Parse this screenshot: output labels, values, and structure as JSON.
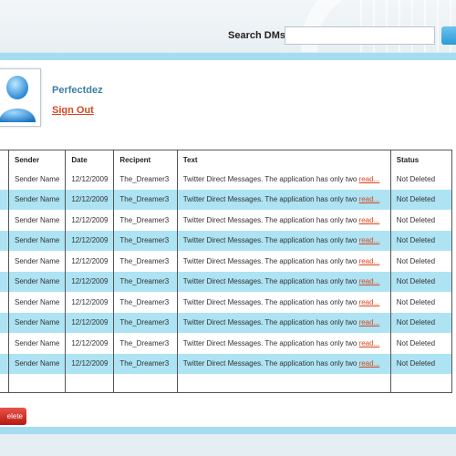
{
  "search": {
    "label": "Search DMs",
    "value": "",
    "placeholder": ""
  },
  "user": {
    "name": "Perfectdez",
    "sign_out": "Sign Out"
  },
  "table": {
    "headers": {
      "sender": "Sender",
      "date": "Date",
      "recipient": "Recipent",
      "text": "Text",
      "status": "Status"
    },
    "rows": [
      {
        "sender": "Sender Name",
        "date": "12/12/2009",
        "recipient": "The_Dreamer3",
        "text": "Twitter Direct Messages. The application has only two",
        "read": "read...",
        "status": "Not Deleted"
      },
      {
        "sender": "Sender Name",
        "date": "12/12/2009",
        "recipient": "The_Dreamer3",
        "text": "Twitter Direct Messages. The application has only two",
        "read": "read...",
        "status": "Not Deleted"
      },
      {
        "sender": "Sender Name",
        "date": "12/12/2009",
        "recipient": "The_Dreamer3",
        "text": "Twitter Direct Messages. The application has only two",
        "read": "read...",
        "status": "Not Deleted"
      },
      {
        "sender": "Sender Name",
        "date": "12/12/2009",
        "recipient": "The_Dreamer3",
        "text": "Twitter Direct Messages. The application has only two",
        "read": "read...",
        "status": "Not Deleted"
      },
      {
        "sender": "Sender Name",
        "date": "12/12/2009",
        "recipient": "The_Dreamer3",
        "text": "Twitter Direct Messages. The application has only two",
        "read": "read...",
        "status": "Not Deleted"
      },
      {
        "sender": "Sender Name",
        "date": "12/12/2009",
        "recipient": "The_Dreamer3",
        "text": "Twitter Direct Messages. The application has only two",
        "read": "read...",
        "status": "Not Deleted"
      },
      {
        "sender": "Sender Name",
        "date": "12/12/2009",
        "recipient": "The_Dreamer3",
        "text": "Twitter Direct Messages. The application has only two",
        "read": "read...",
        "status": "Not Deleted"
      },
      {
        "sender": "Sender Name",
        "date": "12/12/2009",
        "recipient": "The_Dreamer3",
        "text": "Twitter Direct Messages. The application has only two",
        "read": "read...",
        "status": "Not Deleted"
      },
      {
        "sender": "Sender Name",
        "date": "12/12/2009",
        "recipient": "The_Dreamer3",
        "text": "Twitter Direct Messages. The application has only two",
        "read": "read...",
        "status": "Not Deleted"
      },
      {
        "sender": "Sender Name",
        "date": "12/12/2009",
        "recipient": "The_Dreamer3",
        "text": "Twitter Direct Messages. The application has only two",
        "read": "read...",
        "status": "Not Deleted"
      }
    ]
  },
  "actions": {
    "delete_label": "elete"
  },
  "colors": {
    "accent": "#a6dcf0",
    "row_highlight": "#ade3f3",
    "link": "#d8471f",
    "username": "#3a7fa5",
    "delete": "#c8241b"
  },
  "icons": {
    "avatar": "user-avatar-icon",
    "search_button": "search-button-icon"
  }
}
